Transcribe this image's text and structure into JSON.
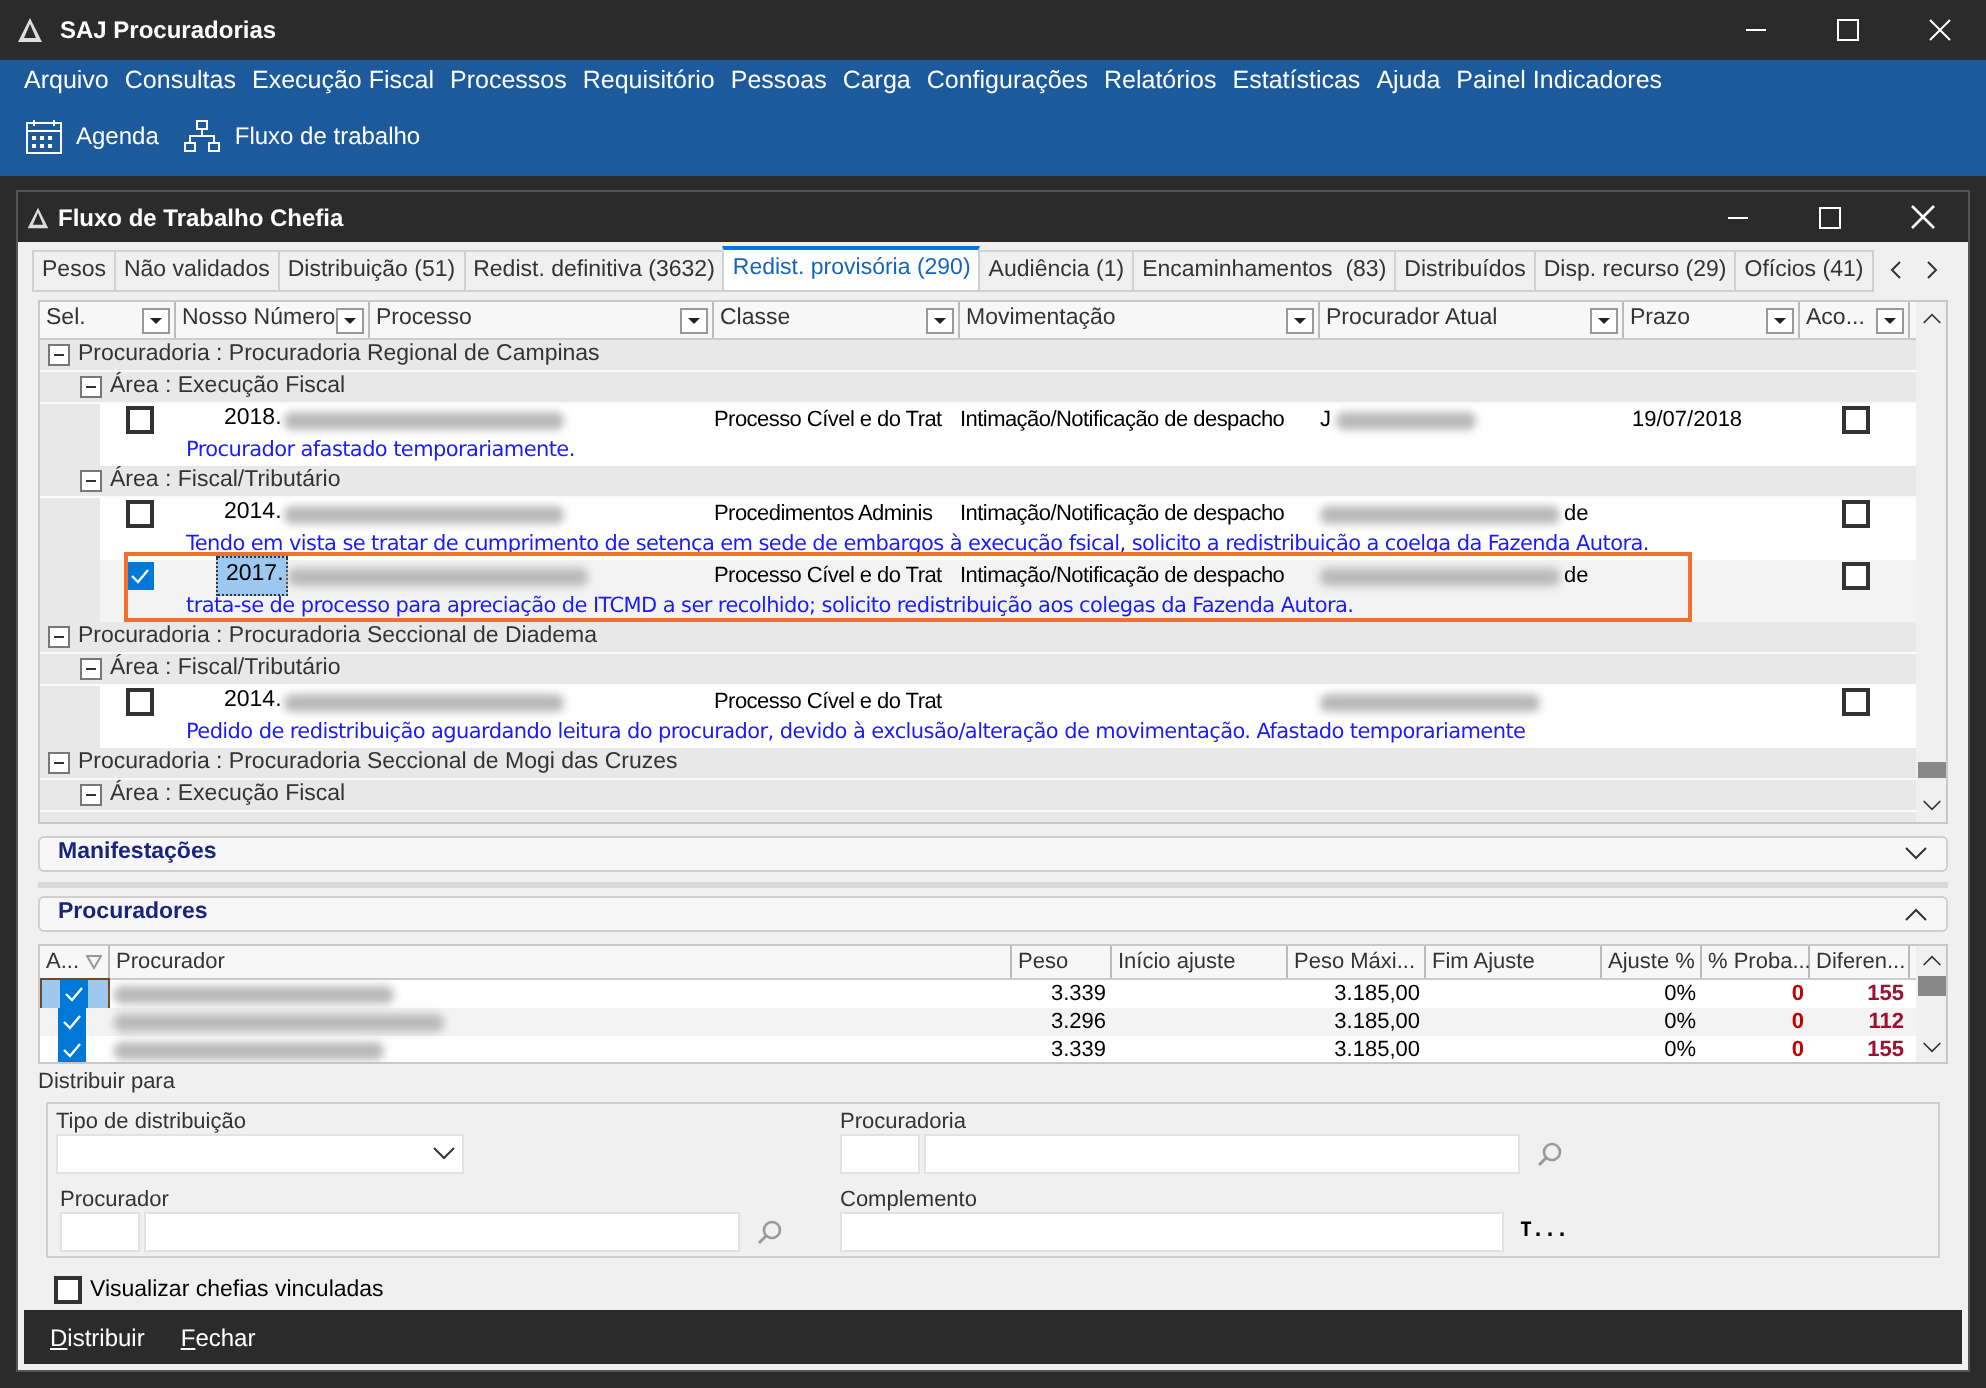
{
  "app_window": {
    "title": "SAJ Procuradorias"
  },
  "menu": [
    "Arquivo",
    "Consultas",
    "Execução Fiscal",
    "Processos",
    "Requisitório",
    "Pessoas",
    "Carga",
    "Configurações",
    "Relatórios",
    "Estatísticas",
    "Ajuda",
    "Painel Indicadores"
  ],
  "toolbar": [
    {
      "kind": "calendar",
      "label": "Agenda"
    },
    {
      "kind": "flow",
      "label": "Fluxo de trabalho"
    }
  ],
  "window": {
    "title": "Fluxo de Trabalho Chefia"
  },
  "tabs": [
    {
      "label": "Pesos",
      "selected": false
    },
    {
      "label": "Não validados",
      "selected": false
    },
    {
      "label": "Distribuição (51)",
      "selected": false
    },
    {
      "label": "Redist. definitiva (3632)",
      "selected": false
    },
    {
      "label": "Redist. provisória (290)",
      "selected": true
    },
    {
      "label": "Audiência (1)",
      "selected": false
    },
    {
      "label": "Encaminhamentos  (83)",
      "selected": false
    },
    {
      "label": "Distribuídos",
      "selected": false
    },
    {
      "label": "Disp. recurso (29)",
      "selected": false
    },
    {
      "label": "Ofícios (41)",
      "selected": false
    }
  ],
  "grid": {
    "columns": [
      "Sel.",
      "Nosso Número",
      "Processo",
      "Classe",
      "Movimentação",
      "Procurador Atual",
      "Prazo",
      "Aco..."
    ],
    "groups": [
      {
        "label": "Procuradoria : Procuradoria Regional de Campinas",
        "expanded": true,
        "children": [
          {
            "label": "Área : Execução Fiscal",
            "expanded": true,
            "records": [
              {
                "checked": false,
                "selected": false,
                "highlighted": false,
                "number": "2018.",
                "classe": "Processo Cível e do Trat",
                "movimentacao": "Intimação/Notificação de despacho",
                "procurador_prefix": "J",
                "prazo": "19/07/2018",
                "aco_checked": false,
                "note": "Procurador afastado temporariamente."
              }
            ]
          },
          {
            "label": "Área : Fiscal/Tributário",
            "expanded": true,
            "records": [
              {
                "checked": false,
                "selected": false,
                "highlighted": false,
                "number": "2014.",
                "classe": "Procedimentos Adminis",
                "movimentacao": "Intimação/Notificação de despacho",
                "procurador_suffix": "de",
                "aco_checked": false,
                "note": "Tendo em vista se tratar de cumprimento de setença em sede de embargos à execução fsical, solicito a redistribuição a coelga da Fazenda Autora."
              },
              {
                "checked": true,
                "selected": true,
                "highlighted": true,
                "number": "2017.",
                "classe": "Processo Cível e do Trat",
                "movimentacao": "Intimação/Notificação de despacho",
                "procurador_suffix": "de",
                "aco_checked": false,
                "note": "trata-se de processo para apreciação de ITCMD a ser recolhido; solicito redistribuição aos colegas da Fazenda Autora."
              }
            ]
          }
        ]
      },
      {
        "label": "Procuradoria : Procuradoria Seccional de Diadema",
        "expanded": true,
        "children": [
          {
            "label": "Área : Fiscal/Tributário",
            "expanded": true,
            "records": [
              {
                "checked": false,
                "selected": false,
                "highlighted": false,
                "number": "2014.",
                "classe": "Processo Cível e do Trat",
                "aco_checked": false,
                "note": "Pedido de redistribuição aguardando leitura do procurador, devido à exclusão/alteração de movimentação. Afastado temporariamente"
              }
            ]
          }
        ]
      },
      {
        "label": "Procuradoria : Procuradoria Seccional de Mogi das Cruzes",
        "expanded": true,
        "children": [
          {
            "label": "Área : Execução Fiscal",
            "expanded": true
          }
        ]
      }
    ]
  },
  "sections": [
    {
      "title": "Manifestações",
      "expanded": false
    },
    {
      "title": "Procuradores",
      "expanded": true
    }
  ],
  "procuradores": {
    "columns": [
      "A...",
      "Procurador",
      "Peso",
      "Início ajuste",
      "Peso Máxi...",
      "Fim Ajuste",
      "Ajuste %",
      "% Proba...",
      "Diferen..."
    ],
    "rows": [
      {
        "checked": true,
        "selected": true,
        "peso": "3.339",
        "peso_maximo": "3.185,00",
        "ajuste": "0%",
        "probabilidade": "0",
        "diferenca": "155"
      },
      {
        "checked": true,
        "selected": false,
        "peso": "3.296",
        "peso_maximo": "3.185,00",
        "ajuste": "0%",
        "probabilidade": "0",
        "diferenca": "112"
      },
      {
        "checked": true,
        "selected": false,
        "peso": "3.339",
        "peso_maximo": "3.185,00",
        "ajuste": "0%",
        "probabilidade": "0",
        "diferenca": "155"
      }
    ]
  },
  "distribuir": {
    "title": "Distribuir para",
    "tipo_label": "Tipo de distribuição",
    "procuradoria_label": "Procuradoria",
    "procurador_label": "Procurador",
    "complemento_label": "Complemento",
    "complemento_button": "T..."
  },
  "visualizar_chefias": {
    "label": "Visualizar chefias vinculadas",
    "checked": false
  },
  "buttons": [
    "Distribuir",
    "Fechar"
  ]
}
